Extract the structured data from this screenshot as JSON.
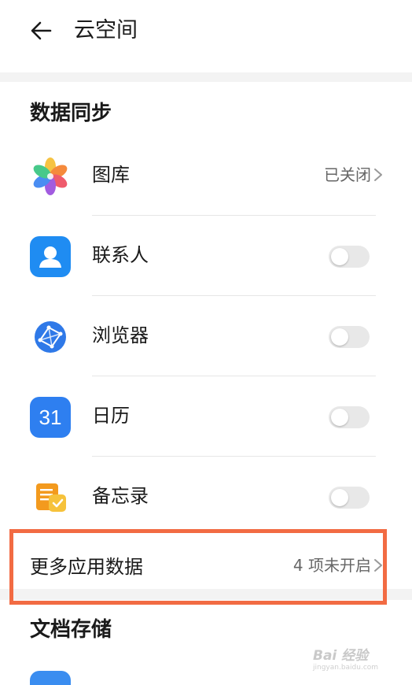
{
  "header": {
    "title": "云空间"
  },
  "sections": {
    "data_sync": "数据同步",
    "doc_storage": "文档存储"
  },
  "rows": [
    {
      "label": "图库",
      "status": "已关闭"
    },
    {
      "label": "联系人",
      "toggle_on": false
    },
    {
      "label": "浏览器",
      "toggle_on": false
    },
    {
      "label": "日历",
      "toggle_on": false,
      "icon_text": "31"
    },
    {
      "label": "备忘录",
      "toggle_on": false
    }
  ],
  "more_apps": {
    "label": "更多应用数据",
    "status": "4 项未开启"
  },
  "watermark": {
    "text": "Bai 经验",
    "url": "jingyan.baidu.com"
  },
  "colors": {
    "highlight": "#f26b43",
    "toggle_off": "#e8e8e8",
    "contacts_blue": "#1f8cf2",
    "calendar_blue": "#2e7ff0",
    "browser_blue": "#2f79e8",
    "memo_orange": "#f39a1e"
  },
  "icons": [
    "back-arrow-icon",
    "gallery-icon",
    "contacts-icon",
    "browser-icon",
    "calendar-icon",
    "memo-icon",
    "chevron-right-icon"
  ]
}
